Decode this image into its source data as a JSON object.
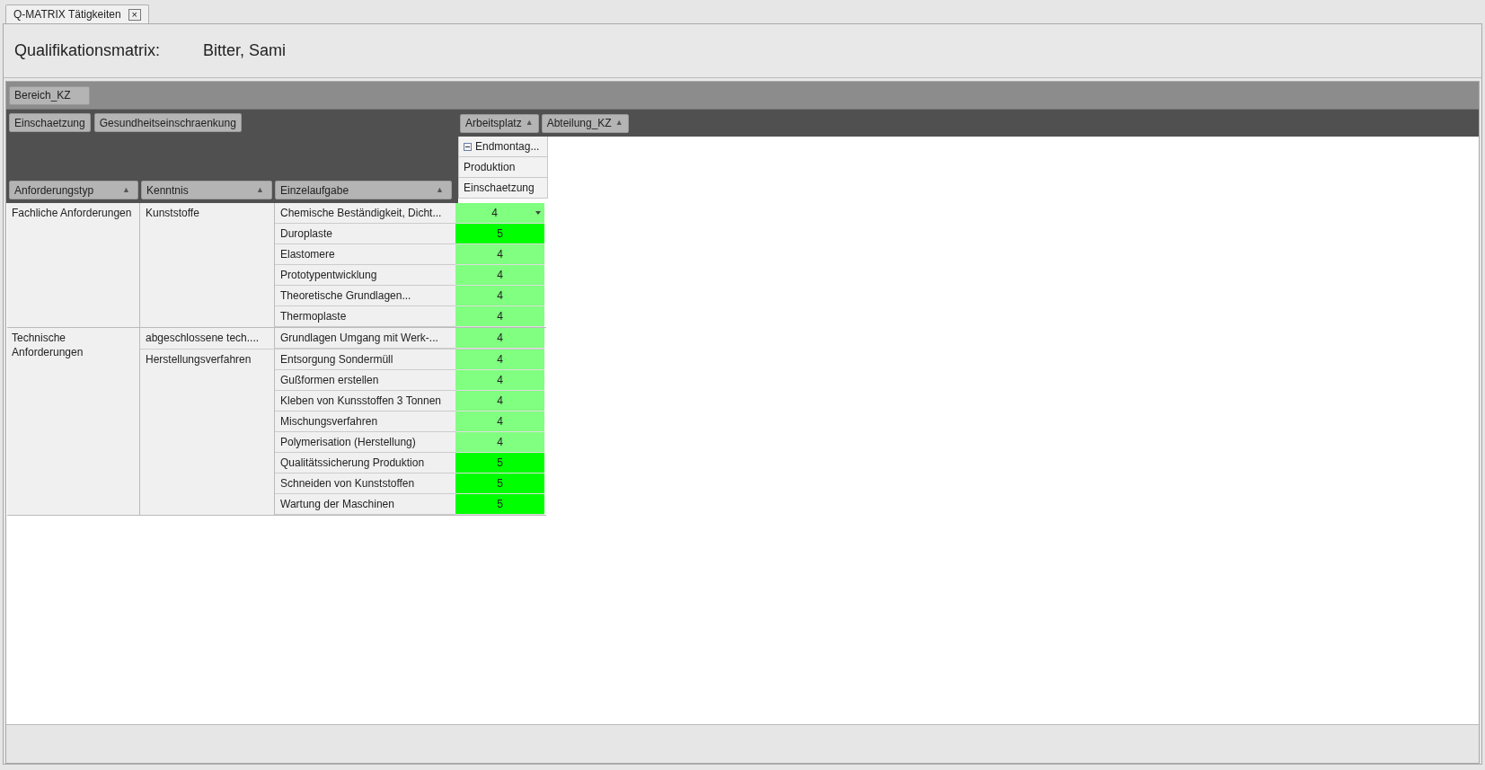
{
  "tab": {
    "title": "Q-MATRIX Tätigkeiten",
    "close": "×"
  },
  "header": {
    "label": "Qualifikationsmatrix:",
    "name": "Bitter, Sami"
  },
  "top_fields": [
    "Bereich_KZ"
  ],
  "filter_fields": [
    "Einschaetzung",
    "Gesundheitseinschraenkung"
  ],
  "column_fields": [
    {
      "label": "Arbeitsplatz",
      "sort": "▲"
    },
    {
      "label": "Abteilung_KZ",
      "sort": "▲"
    }
  ],
  "row_fields": [
    {
      "label": "Anforderungstyp",
      "sort": "▲"
    },
    {
      "label": "Kenntnis",
      "sort": "▲"
    },
    {
      "label": "Einzelaufgabe",
      "sort": "▲"
    }
  ],
  "column_headers": [
    {
      "label": "Endmontag...",
      "expanded": true
    },
    {
      "label": "Produktion"
    },
    {
      "label": "Einschaetzung"
    }
  ],
  "groups": [
    {
      "name": "Fachliche Anforderungen",
      "children": [
        {
          "name": "Kunststoffe",
          "children": [
            {
              "task": "Chemische Beständigkeit, Dicht...",
              "value": "4",
              "color": "#80ff80",
              "dropdown": true
            },
            {
              "task": "Duroplaste",
              "value": "5",
              "color": "#00ff00",
              "dropdown": false
            },
            {
              "task": "Elastomere",
              "value": "4",
              "color": "#80ff80",
              "dropdown": false
            },
            {
              "task": "Prototypentwicklung",
              "value": "4",
              "color": "#80ff80",
              "dropdown": false
            },
            {
              "task": "Theoretische Grundlagen...",
              "value": "4",
              "color": "#80ff80",
              "dropdown": false
            },
            {
              "task": "Thermoplaste",
              "value": "4",
              "color": "#80ff80",
              "dropdown": false
            }
          ]
        }
      ]
    },
    {
      "name": "Technische Anforderungen",
      "children": [
        {
          "name": "abgeschlossene tech....",
          "children": [
            {
              "task": "Grundlagen Umgang mit Werk-...",
              "value": "4",
              "color": "#80ff80",
              "dropdown": false
            }
          ]
        },
        {
          "name": "Herstellungsverfahren",
          "children": [
            {
              "task": "Entsorgung Sondermüll",
              "value": "4",
              "color": "#80ff80",
              "dropdown": false
            },
            {
              "task": "Gußformen erstellen",
              "value": "4",
              "color": "#80ff80",
              "dropdown": false
            },
            {
              "task": "Kleben von Kunsstoffen 3 Tonnen",
              "value": "4",
              "color": "#80ff80",
              "dropdown": false
            },
            {
              "task": "Mischungsverfahren",
              "value": "4",
              "color": "#80ff80",
              "dropdown": false
            },
            {
              "task": "Polymerisation (Herstellung)",
              "value": "4",
              "color": "#80ff80",
              "dropdown": false
            },
            {
              "task": "Qualitätssicherung Produktion",
              "value": "5",
              "color": "#00ff00",
              "dropdown": false
            },
            {
              "task": "Schneiden von Kunststoffen",
              "value": "5",
              "color": "#00ff00",
              "dropdown": false
            },
            {
              "task": "Wartung der Maschinen",
              "value": "5",
              "color": "#00ff00",
              "dropdown": false
            }
          ]
        }
      ]
    }
  ]
}
